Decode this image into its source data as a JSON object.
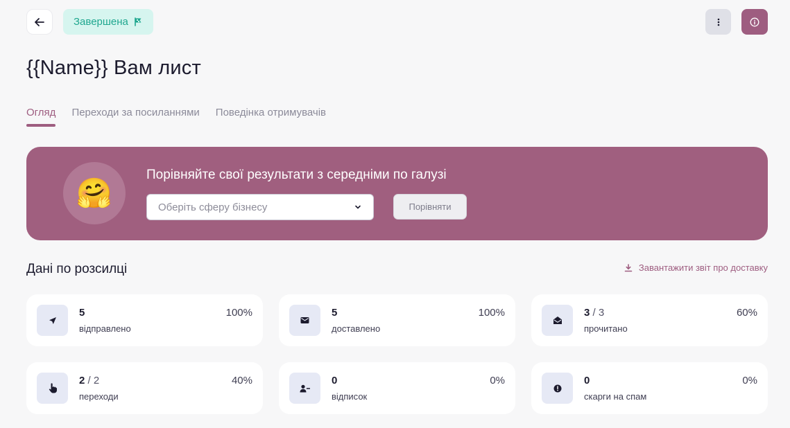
{
  "header": {
    "status": "Завершена",
    "title": "{{Name}} Вам лист"
  },
  "tabs": [
    {
      "label": "Огляд",
      "active": true
    },
    {
      "label": "Переходи за посиланнями",
      "active": false
    },
    {
      "label": "Поведінка отримувачів",
      "active": false
    }
  ],
  "banner": {
    "emoji": "🤗",
    "title": "Порівняйте свої результати з середніми по галузі",
    "select_placeholder": "Оберіть сферу бізнесу",
    "compare_label": "Порівняти"
  },
  "stats_section": {
    "title": "Дані по розсилці",
    "download_label": "Завантажити звіт про доставку"
  },
  "stats": [
    {
      "icon": "send-icon",
      "value": "5",
      "sub": "",
      "label": "відправлено",
      "pct": "100%"
    },
    {
      "icon": "envelope-icon",
      "value": "5",
      "sub": "",
      "label": "доставлено",
      "pct": "100%"
    },
    {
      "icon": "envelope-open-icon",
      "value": "3",
      "sub": " / 3",
      "label": "прочитано",
      "pct": "60%"
    },
    {
      "icon": "pointer-hand-icon",
      "value": "2",
      "sub": " / 2",
      "label": "переходи",
      "pct": "40%"
    },
    {
      "icon": "user-minus-icon",
      "value": "0",
      "sub": "",
      "label": "відписок",
      "pct": "0%"
    },
    {
      "icon": "alert-icon",
      "value": "0",
      "sub": "",
      "label": "скарги на спам",
      "pct": "0%"
    }
  ],
  "colors": {
    "accent": "#9e5d80",
    "status_bg": "#d6f5ef",
    "status_text": "#1fa78f"
  }
}
